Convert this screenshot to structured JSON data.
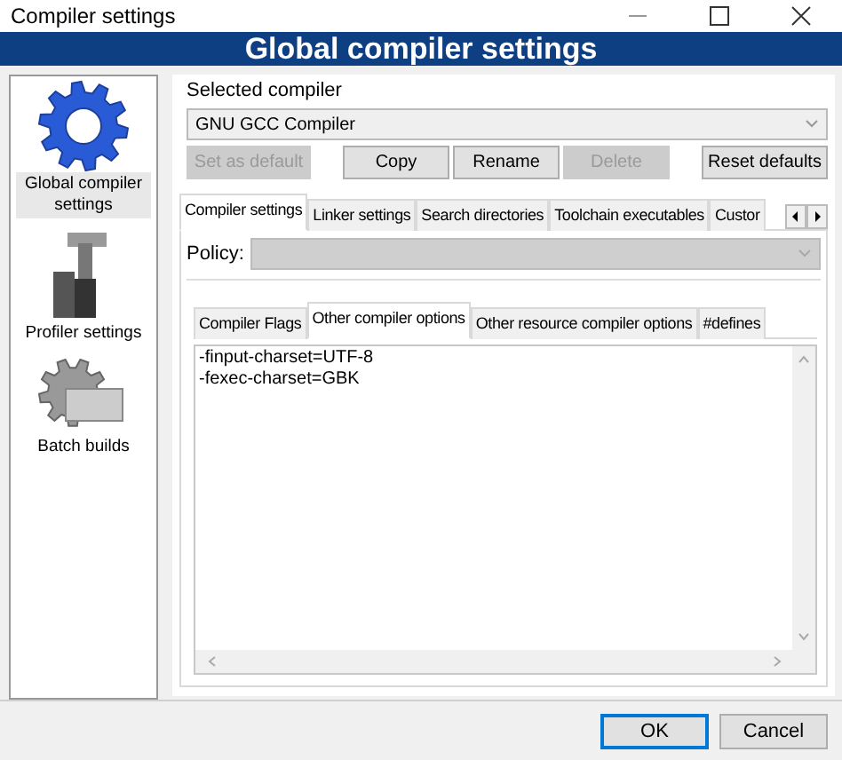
{
  "window": {
    "title": "Compiler settings"
  },
  "header": "Global compiler settings",
  "sidebar": {
    "items": [
      {
        "label": "Global compiler settings",
        "kind": "gear",
        "selected": true
      },
      {
        "label": "Profiler settings",
        "kind": "profiler",
        "selected": false
      },
      {
        "label": "Batch builds",
        "kind": "batch",
        "selected": false
      }
    ]
  },
  "selected_compiler": {
    "label": "Selected compiler",
    "value": "GNU GCC Compiler"
  },
  "compiler_buttons": [
    {
      "label": "Set as default",
      "disabled": true
    },
    {
      "label": "Copy",
      "disabled": false
    },
    {
      "label": "Rename",
      "disabled": false
    },
    {
      "label": "Delete",
      "disabled": true
    },
    {
      "label": "Reset defaults",
      "disabled": false
    }
  ],
  "tabs": [
    {
      "label": "Compiler settings",
      "selected": true
    },
    {
      "label": "Linker settings",
      "selected": false
    },
    {
      "label": "Search directories",
      "selected": false
    },
    {
      "label": "Toolchain executables",
      "selected": false
    },
    {
      "label": "Custor",
      "selected": false
    }
  ],
  "policy": {
    "label": "Policy:",
    "disabled": true
  },
  "inner_tabs": [
    {
      "label": "Compiler Flags",
      "selected": false
    },
    {
      "label": "Other compiler options",
      "selected": true
    },
    {
      "label": "Other resource compiler options",
      "selected": false
    },
    {
      "label": "#defines",
      "selected": false
    }
  ],
  "options_text": [
    "-finput-charset=UTF-8",
    "-fexec-charset=GBK"
  ],
  "dialog_buttons": [
    {
      "label": "OK",
      "default": true
    },
    {
      "label": "Cancel",
      "default": false
    }
  ]
}
